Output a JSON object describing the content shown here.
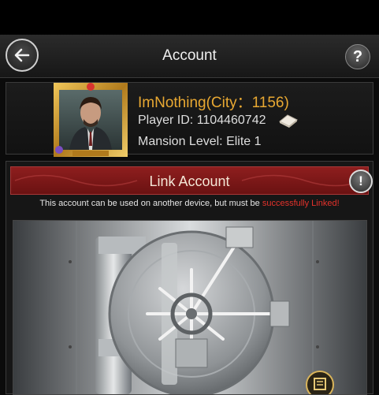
{
  "header": {
    "title": "Account",
    "back_icon": "arrow-left-icon",
    "help_label": "?"
  },
  "profile": {
    "name": "ImNothing(City：1156)",
    "player_id_label": "Player ID: 1104460742",
    "mansion_label": "Mansion Level: Elite 1",
    "copy_icon": "eraser-copy-icon",
    "avatar_icon": "character-portrait"
  },
  "link_account": {
    "title": "Link Account",
    "info_label": "!",
    "notice_prefix": "This account can be used on another device, but must be ",
    "notice_highlight": "successfully Linked",
    "notice_suffix": "!",
    "vault_icon": "vault-door-illustration"
  },
  "colors": {
    "gold": "#e8a832",
    "banner_red": "#8e1e1e",
    "highlight_red": "#e5322b"
  }
}
